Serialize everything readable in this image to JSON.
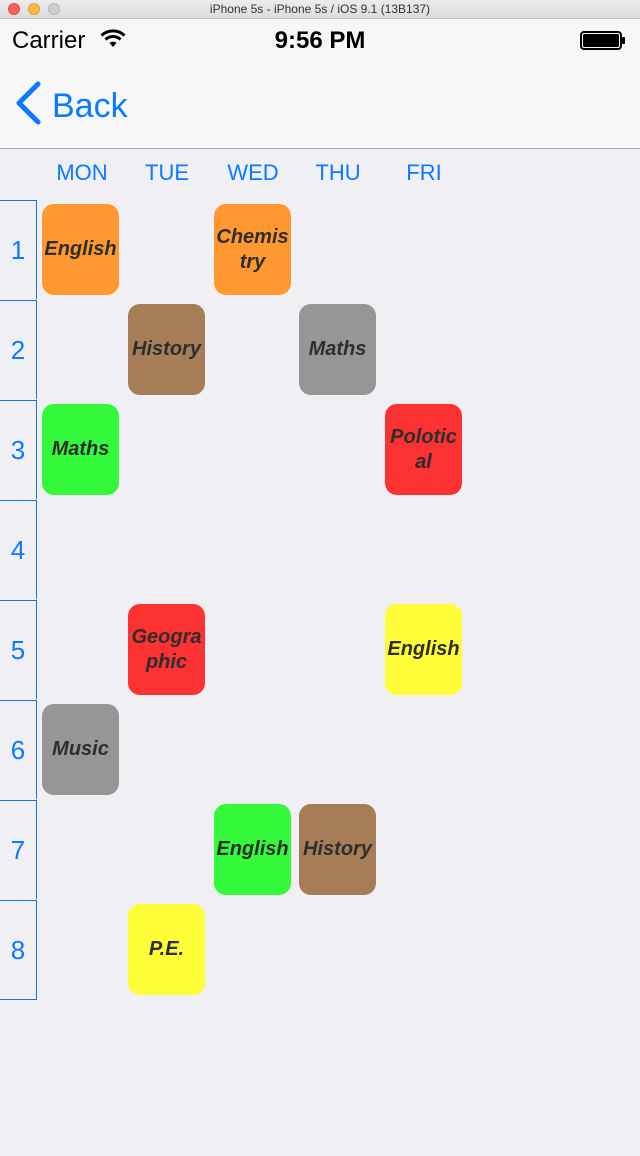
{
  "window": {
    "title": "iPhone 5s - iPhone 5s / iOS 9.1 (13B137)"
  },
  "status": {
    "carrier": "Carrier",
    "time": "9:56 PM"
  },
  "nav": {
    "back_label": "Back"
  },
  "days": [
    "MON",
    "TUE",
    "WED",
    "THU",
    "FRI"
  ],
  "periods": [
    "1",
    "2",
    "3",
    "4",
    "5",
    "6",
    "7",
    "8"
  ],
  "colors": {
    "orange": "#ff9831",
    "brown": "#a67d56",
    "gray": "#969696",
    "green": "#34f93a",
    "red": "#fc3131",
    "yellow": "#fffd38",
    "accent": "#0a7aff"
  },
  "schedule": [
    {
      "day": 0,
      "period": 0,
      "subject": "English",
      "color": "#ff9831"
    },
    {
      "day": 2,
      "period": 0,
      "subject": "Chemistry",
      "color": "#ff9831"
    },
    {
      "day": 1,
      "period": 1,
      "subject": "History",
      "color": "#a67d56"
    },
    {
      "day": 3,
      "period": 1,
      "subject": "Maths",
      "color": "#969696"
    },
    {
      "day": 0,
      "period": 2,
      "subject": "Maths",
      "color": "#34f93a"
    },
    {
      "day": 4,
      "period": 2,
      "subject": "Polotical",
      "color": "#fc3131"
    },
    {
      "day": 1,
      "period": 4,
      "subject": "Geographic",
      "color": "#fc3131"
    },
    {
      "day": 4,
      "period": 4,
      "subject": "English",
      "color": "#fffd38"
    },
    {
      "day": 0,
      "period": 5,
      "subject": "Music",
      "color": "#969696"
    },
    {
      "day": 2,
      "period": 6,
      "subject": "English",
      "color": "#34f93a"
    },
    {
      "day": 3,
      "period": 6,
      "subject": "History",
      "color": "#a67d56"
    },
    {
      "day": 1,
      "period": 7,
      "subject": "P.E.",
      "color": "#fffd38"
    }
  ]
}
